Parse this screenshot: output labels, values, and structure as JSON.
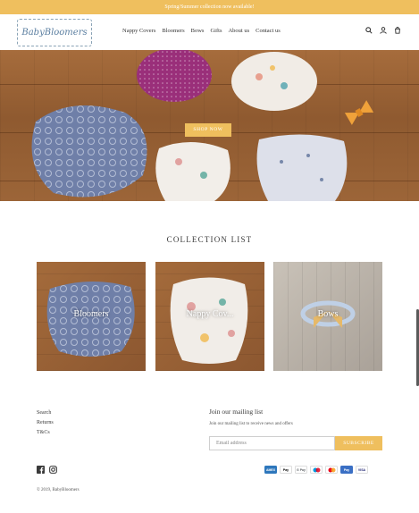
{
  "announcement": "Spring/Summer collection now available!",
  "header": {
    "logo_text": "BabyBloomers",
    "nav": [
      "Nappy Covers",
      "Bloomers",
      "Bows",
      "Gifts",
      "About us",
      "Contact us"
    ],
    "icons": [
      "search-icon",
      "account-icon",
      "cart-icon"
    ]
  },
  "hero": {
    "button_label": "SHOP NOW"
  },
  "collections": {
    "title": "COLLECTION LIST",
    "items": [
      {
        "label": "Bloomers"
      },
      {
        "label": "Nappy Cov..."
      },
      {
        "label": "Bows"
      }
    ]
  },
  "footer": {
    "links": [
      "Search",
      "Returns",
      "T&Cs"
    ],
    "mailing_title": "Join our mailing list",
    "mailing_sub": "Join our mailing list to receive news and offers",
    "email_placeholder": "Email address",
    "subscribe_label": "SUBSCRIBE",
    "social": [
      "facebook-icon",
      "instagram-icon"
    ],
    "payments": [
      "AMEX",
      "Pay",
      "G Pay",
      "maestro",
      "mastercard",
      "Pay",
      "VISA"
    ],
    "copyright": "© 2019, BabyBloomers"
  },
  "colors": {
    "accent": "#efbf5e",
    "text": "#3a3a3a"
  }
}
